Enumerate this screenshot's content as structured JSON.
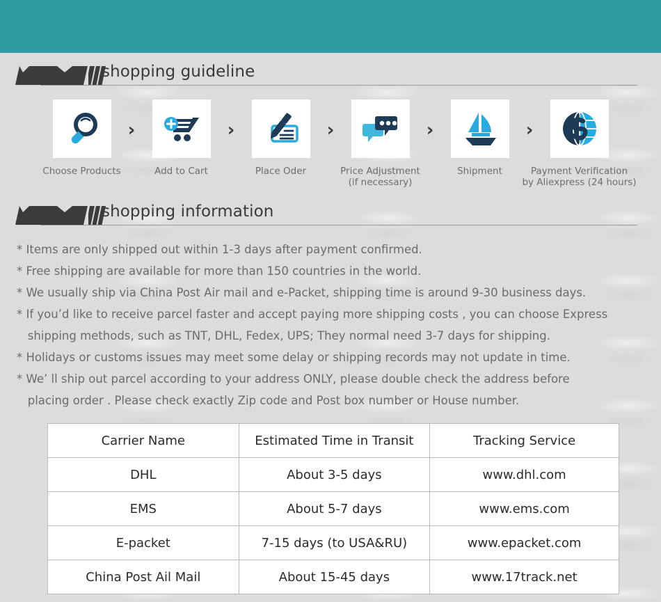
{
  "theme": {
    "header_teal": "#2f9aa0",
    "page_background": "#dcdcdc",
    "icon_dark": "#1d3a57",
    "icon_blue": "#29abe2",
    "banner_dark": "#3b3b3b",
    "body_text": "#6b6b6b",
    "table_border": "#b9b9b9"
  },
  "sections": {
    "guideline": {
      "title": "shopping guideline"
    },
    "information": {
      "title": "shopping information"
    }
  },
  "steps": [
    {
      "icon": "magnifier-icon",
      "label": "Choose Products"
    },
    {
      "icon": "add-to-cart-icon",
      "label": "Add to Cart"
    },
    {
      "icon": "pen-check-icon",
      "label": "Place Oder"
    },
    {
      "icon": "chat-bubbles-icon",
      "label": "Price Adjustment\n(if necessary)"
    },
    {
      "icon": "sailboat-icon",
      "label": "Shipment"
    },
    {
      "icon": "dollar-globe-icon",
      "label": "Payment Verification\nby  Aliexpress (24 hours)"
    }
  ],
  "step_separator": "›",
  "information_lines": [
    "* Items are only shipped out within 1-3 days after payment confirmed.",
    "* Free shipping are available for more than 150 countries in the world.",
    "* We usually ship via China Post Air mail and e-Packet, shipping time is around 9-30 business days.",
    "* If you’d like to receive parcel faster and accept paying more shipping costs , you can choose Express",
    "   shipping methods, such as TNT, DHL, Fedex, UPS; They normal need 3-7 days for shipping.",
    "* Holidays or customs issues may meet some delay or shipping records may not update in time.",
    "* We’ ll ship out parcel according to your address ONLY, please double check the address before",
    "   placing order . Please check exactly Zip code and Post box number or House number."
  ],
  "carrier_table": {
    "headers": [
      "Carrier Name",
      "Estimated Time in Transit",
      "Tracking Service"
    ],
    "rows": [
      [
        "DHL",
        "About 3-5 days",
        "www.dhl.com"
      ],
      [
        "EMS",
        "About 5-7 days",
        "www.ems.com"
      ],
      [
        "E-packet",
        "7-15 days (to USA&RU)",
        "www.epacket.com"
      ],
      [
        "China Post Ail Mail",
        "About 15-45 days",
        "www.17track.net"
      ]
    ]
  }
}
